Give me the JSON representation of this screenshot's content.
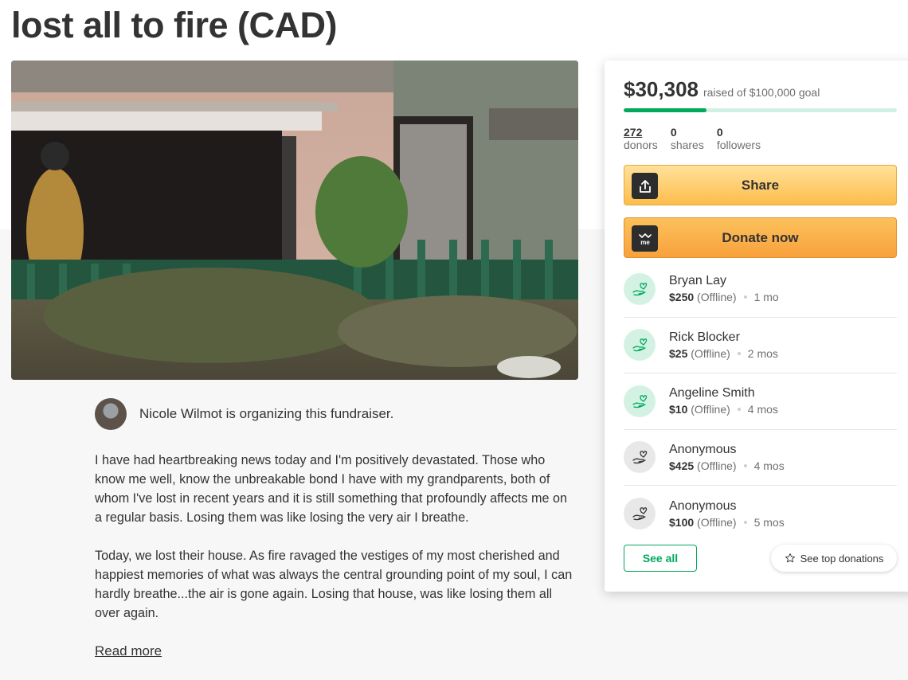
{
  "campaign": {
    "title": "lost all to fire (CAD)"
  },
  "organizer": {
    "text": "Nicole Wilmot is organizing this fundraiser."
  },
  "story": {
    "paragraphs": [
      "I have had heartbreaking news today and I'm positively devastated. Those who know me well, know the unbreakable bond I have with my grandparents, both of whom I've lost in recent years and it is still something that profoundly affects me on a regular basis. Losing them was like losing the very air I breathe.",
      "Today, we lost their house. As fire ravaged the vestiges of my most cherished and happiest memories of what was always the central grounding point of my soul, I can hardly breathe...the air is gone again. Losing that house, was like losing them all over again."
    ],
    "read_more": "Read more"
  },
  "progress": {
    "raised": "$30,308",
    "goal_text": "raised of $100,000 goal",
    "fraction": 0.30308,
    "accent_color": "#02a95c"
  },
  "stats": [
    {
      "value": "272",
      "label": "donors"
    },
    {
      "value": "0",
      "label": "shares"
    },
    {
      "value": "0",
      "label": "followers"
    }
  ],
  "buttons": {
    "share": "Share",
    "donate": "Donate now",
    "share_icon": "share-upload-icon",
    "donate_icon": "gofundme-logo-icon"
  },
  "donations": [
    {
      "name": "Bryan Lay",
      "amount": "$250",
      "note": "(Offline)",
      "time": "1 mo",
      "avatar": "green"
    },
    {
      "name": "Rick Blocker",
      "amount": "$25",
      "note": "(Offline)",
      "time": "2 mos",
      "avatar": "green"
    },
    {
      "name": "Angeline Smith",
      "amount": "$10",
      "note": "(Offline)",
      "time": "4 mos",
      "avatar": "green"
    },
    {
      "name": "Anonymous",
      "amount": "$425",
      "note": "(Offline)",
      "time": "4 mos",
      "avatar": "gray"
    },
    {
      "name": "Anonymous",
      "amount": "$100",
      "note": "(Offline)",
      "time": "5 mos",
      "avatar": "gray"
    }
  ],
  "donation_actions": {
    "see_all": "See all",
    "see_top": "See top donations"
  }
}
